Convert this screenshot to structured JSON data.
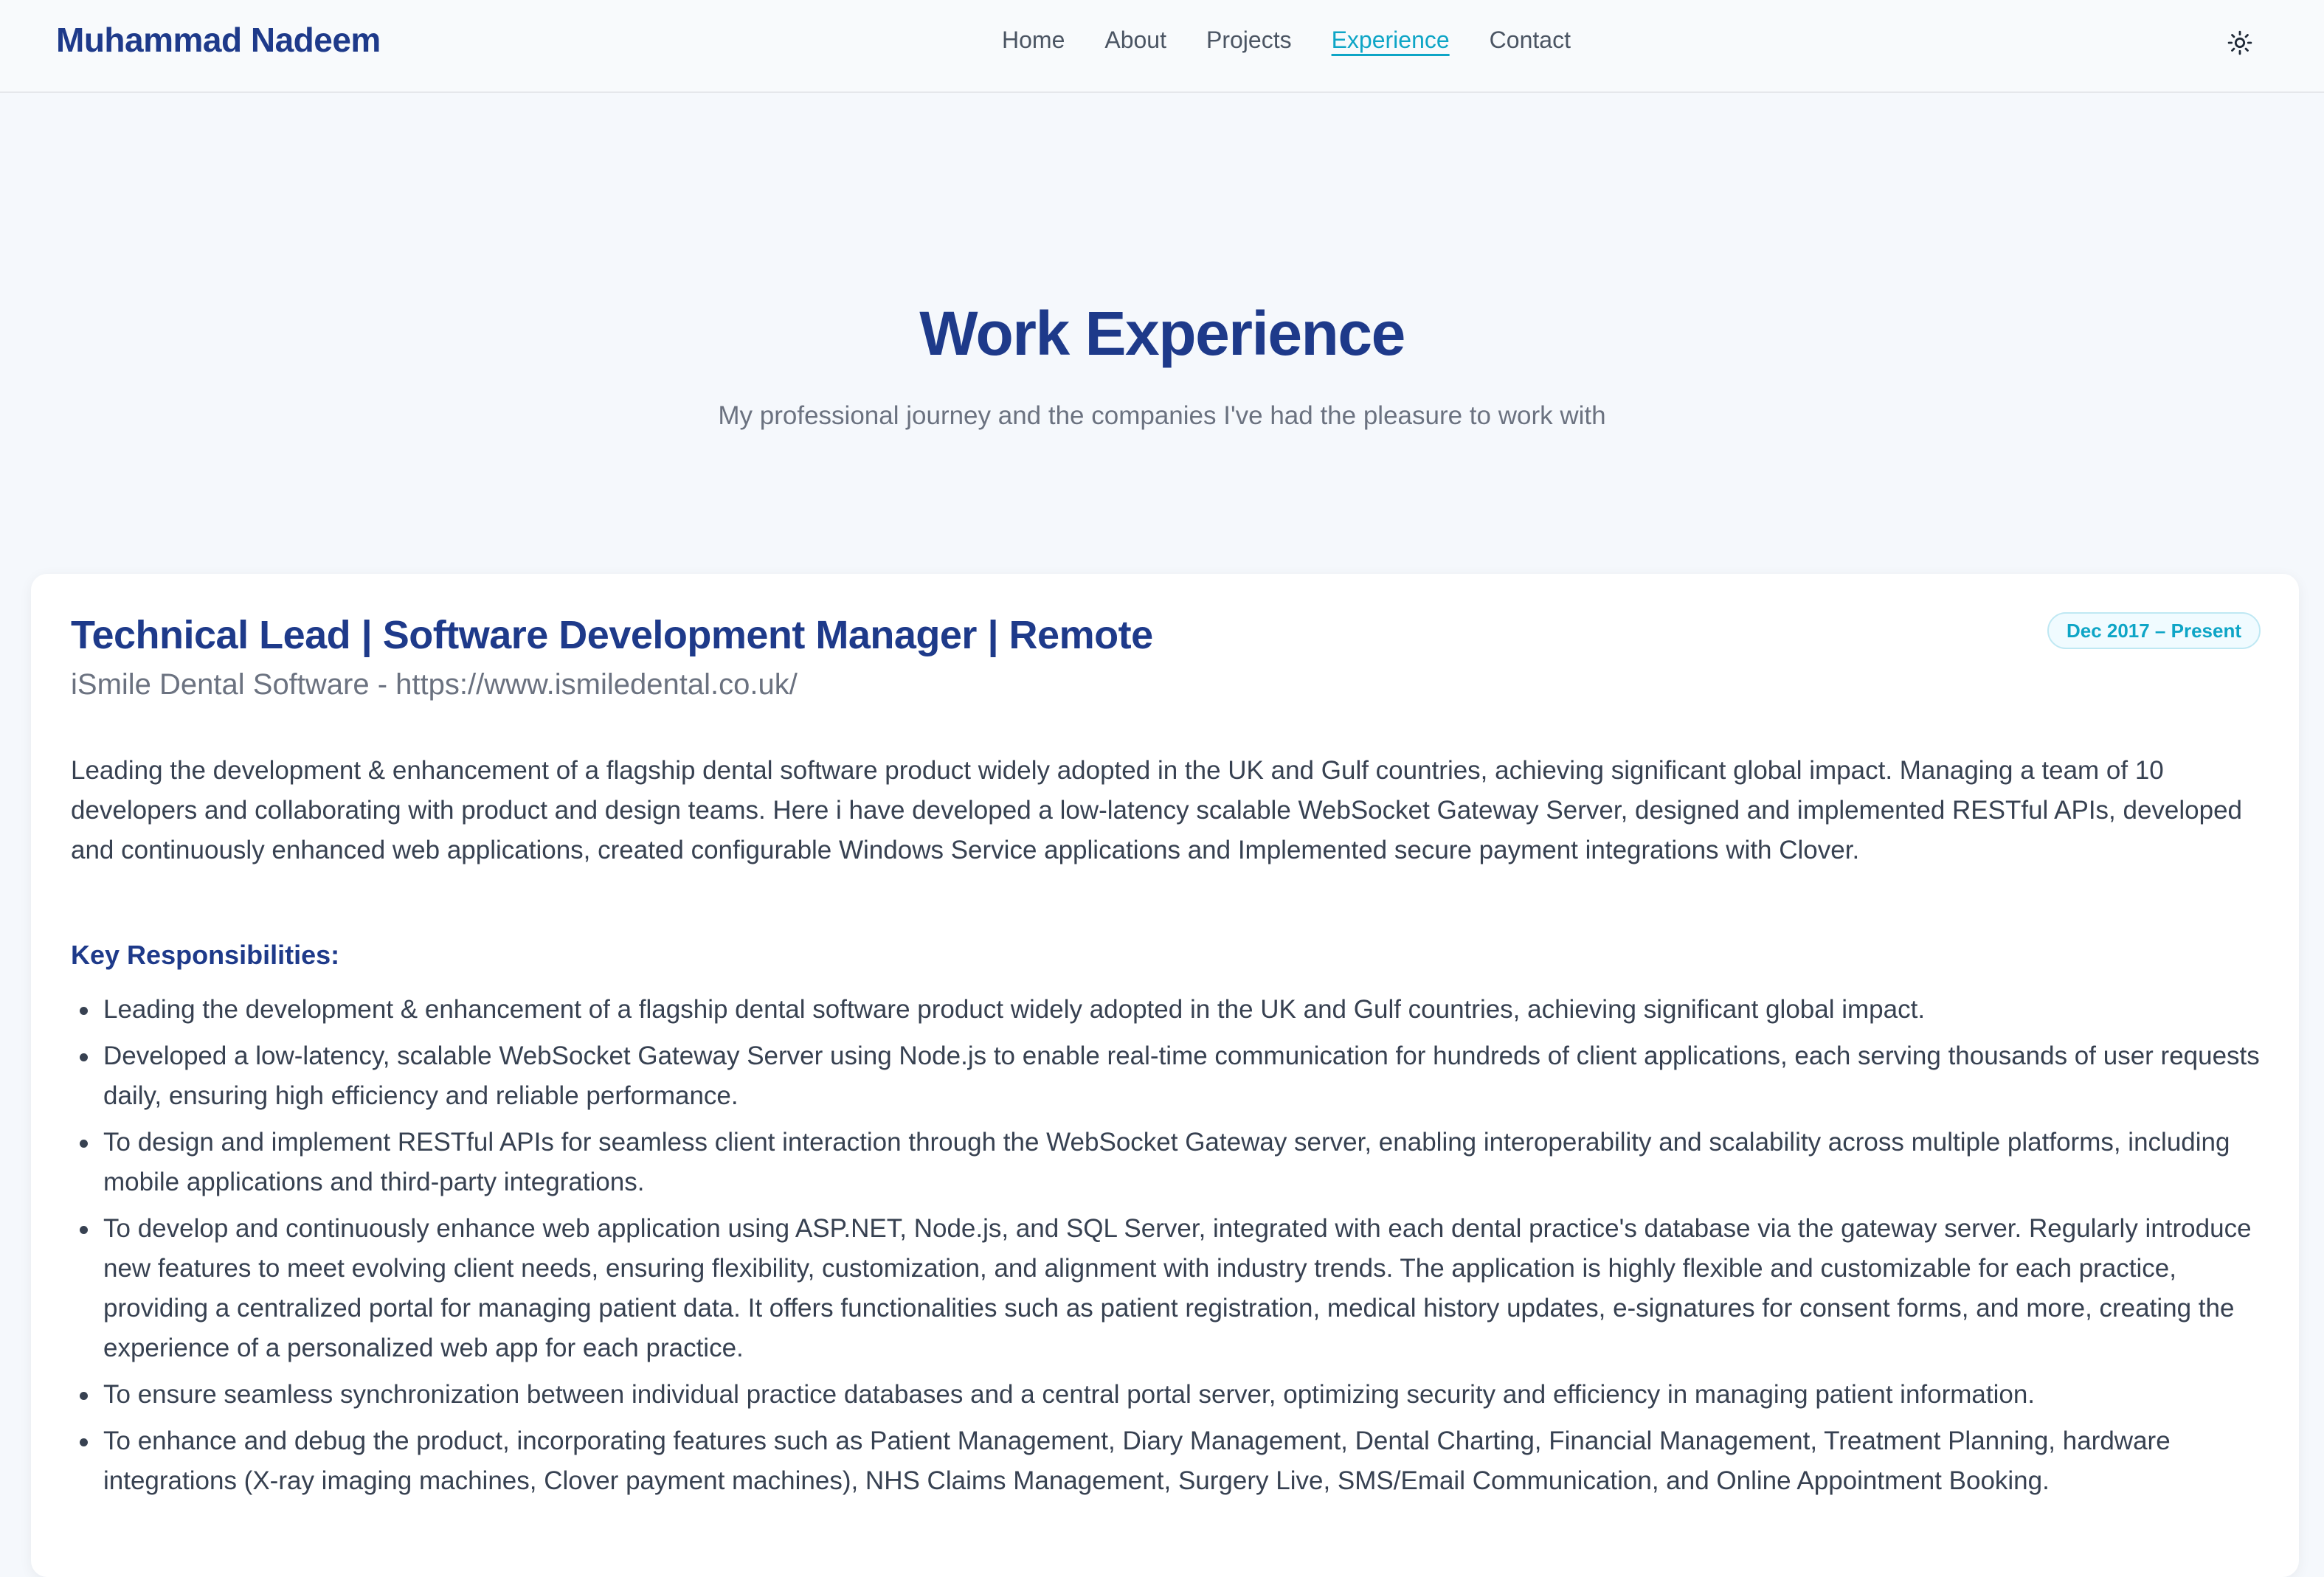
{
  "nav": {
    "brand": "Muhammad Nadeem",
    "links": [
      "Home",
      "About",
      "Projects",
      "Experience",
      "Contact"
    ],
    "active": "Experience",
    "theme_icon": "sun-icon"
  },
  "hero": {
    "title": "Work Experience",
    "subtitle": "My professional journey and the companies I've had the pleasure to work with"
  },
  "job": {
    "title": "Technical Lead | Software Development Manager | Remote",
    "company": "iSmile Dental Software - https://www.ismiledental.co.uk/",
    "dates": "Dec 2017 – Present",
    "summary": "Leading the development & enhancement of a flagship dental software product widely adopted in the UK and Gulf countries, achieving significant global impact. Managing a team of 10 developers and collaborating with product and design teams. Here i have developed a low-latency scalable WebSocket Gateway Server, designed and implemented RESTful APIs, developed and continuously enhanced web applications, created configurable Windows Service applications and Implemented secure payment integrations with Clover.",
    "responsibilities_heading": "Key Responsibilities:",
    "responsibilities": [
      "Leading the development & enhancement of a flagship dental software product widely adopted in the UK and Gulf countries, achieving significant global impact.",
      "Developed a low-latency, scalable WebSocket Gateway Server using Node.js to enable real-time communication for hundreds of client applications, each serving thousands of user requests daily, ensuring high efficiency and reliable performance.",
      "To design and implement RESTful APIs for seamless client interaction through the WebSocket Gateway server, enabling interoperability and scalability across multiple platforms, including mobile applications and third-party integrations.",
      "To develop and continuously enhance web application using ASP.NET, Node.js, and SQL Server, integrated with each dental practice's database via the gateway server. Regularly introduce new features to meet evolving client needs, ensuring flexibility, customization, and alignment with industry trends. The application is highly flexible and customizable for each practice, providing a centralized portal for managing patient data. It offers functionalities such as patient registration, medical history updates, e-signatures for consent forms, and more, creating the experience of a personalized web app for each practice.",
      "To ensure seamless synchronization between individual practice databases and a central portal server, optimizing security and efficiency in managing patient information.",
      "To enhance and debug the product, incorporating features such as Patient Management, Diary Management, Dental Charting, Financial Management, Treatment Planning, hardware integrations (X-ray imaging machines, Clover payment machines), NHS Claims Management, Surgery Live, SMS/Email Communication, and Online Appointment Booking."
    ]
  },
  "colors": {
    "primary": "#1e3a8a",
    "accent": "#0ea5c6",
    "background": "#f5f8fc",
    "card": "#ffffff",
    "text": "#374151",
    "muted": "#6b7280"
  }
}
